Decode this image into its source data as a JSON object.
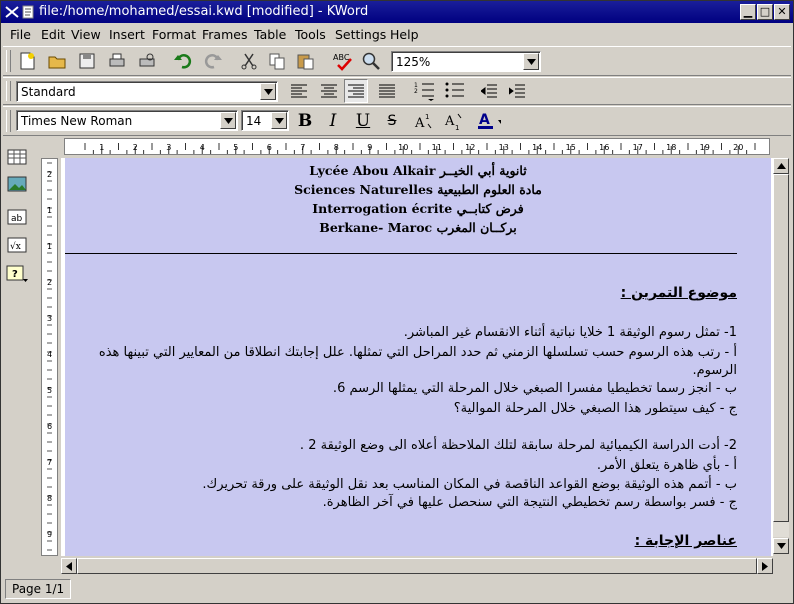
{
  "window": {
    "title": "file:/home/mohamed/essai.kwd [modified] - KWord"
  },
  "menu": [
    "File",
    "Edit",
    "View",
    "Insert",
    "Format",
    "Frames",
    "Table",
    "Tools",
    "Settings",
    "Help"
  ],
  "toolbar": {
    "zoom": "125%"
  },
  "format": {
    "style": "Standard",
    "font": "Times New Roman",
    "size": "14"
  },
  "header": {
    "line1": "Lycée Abou Alkair  ثانوية أبي الخيــر",
    "line2": "Sciences Naturelles  مادة العلوم الطبيعية",
    "line3": "Interrogation écrite  فرض كتابــي",
    "line4": "Berkane- Maroc  بركــان المغرب"
  },
  "body": {
    "title": "موضوع التمرين :",
    "p1": "1- تمثل رسوم الوثيقة 1 خلايا نباتية أثناء الانقسام غير المباشر.",
    "p2a": "أ - رتب هذه الرسوم حسب تسلسلها الزمني ثم حدد المراحل التي تمثلها. علل إجابتك انطلاقا من المعايير التي تبينها هذه",
    "p2b": "الرسوم.",
    "p3": "ب - انجز رسما تخطيطيا مفسرا الصبغي خلال المرحلة التي يمثلها الرسم 6.",
    "p4": "ج - كيف سيتطور هذا الصبغي خلال المرحلة الموالية؟",
    "p5": "2- أدت الدراسة الكيميائية لمرحلة سابقة لتلك الملاحظة أعلاه الى وضع الوثيقة 2 .",
    "p6": "أ - بأي ظاهرة يتعلق الأمر.",
    "p7": "ب - أتمم هذه الوثيقة بوضع القواعد الناقصة في المكان المناسب بعد نقل الوثيقة على ورقة تحريرك.",
    "p8": "ج - فسر بواسطة رسم تخطيطي النتيجة التي سنحصل عليها في آخر الظاهرة.",
    "title2": "عناصر الإجابة :"
  },
  "ruler": {
    "marks": [
      "1",
      "2",
      "3",
      "4",
      "5",
      "6",
      "7",
      "8",
      "9",
      "10",
      "11",
      "12",
      "13",
      "14",
      "15",
      "16",
      "17",
      "18",
      "19",
      "20"
    ]
  },
  "vruler": {
    "marks": [
      "2",
      "1",
      "1",
      "2",
      "3",
      "4",
      "5",
      "6",
      "7",
      "8",
      "9"
    ]
  },
  "status": {
    "page": "Page 1/1"
  }
}
